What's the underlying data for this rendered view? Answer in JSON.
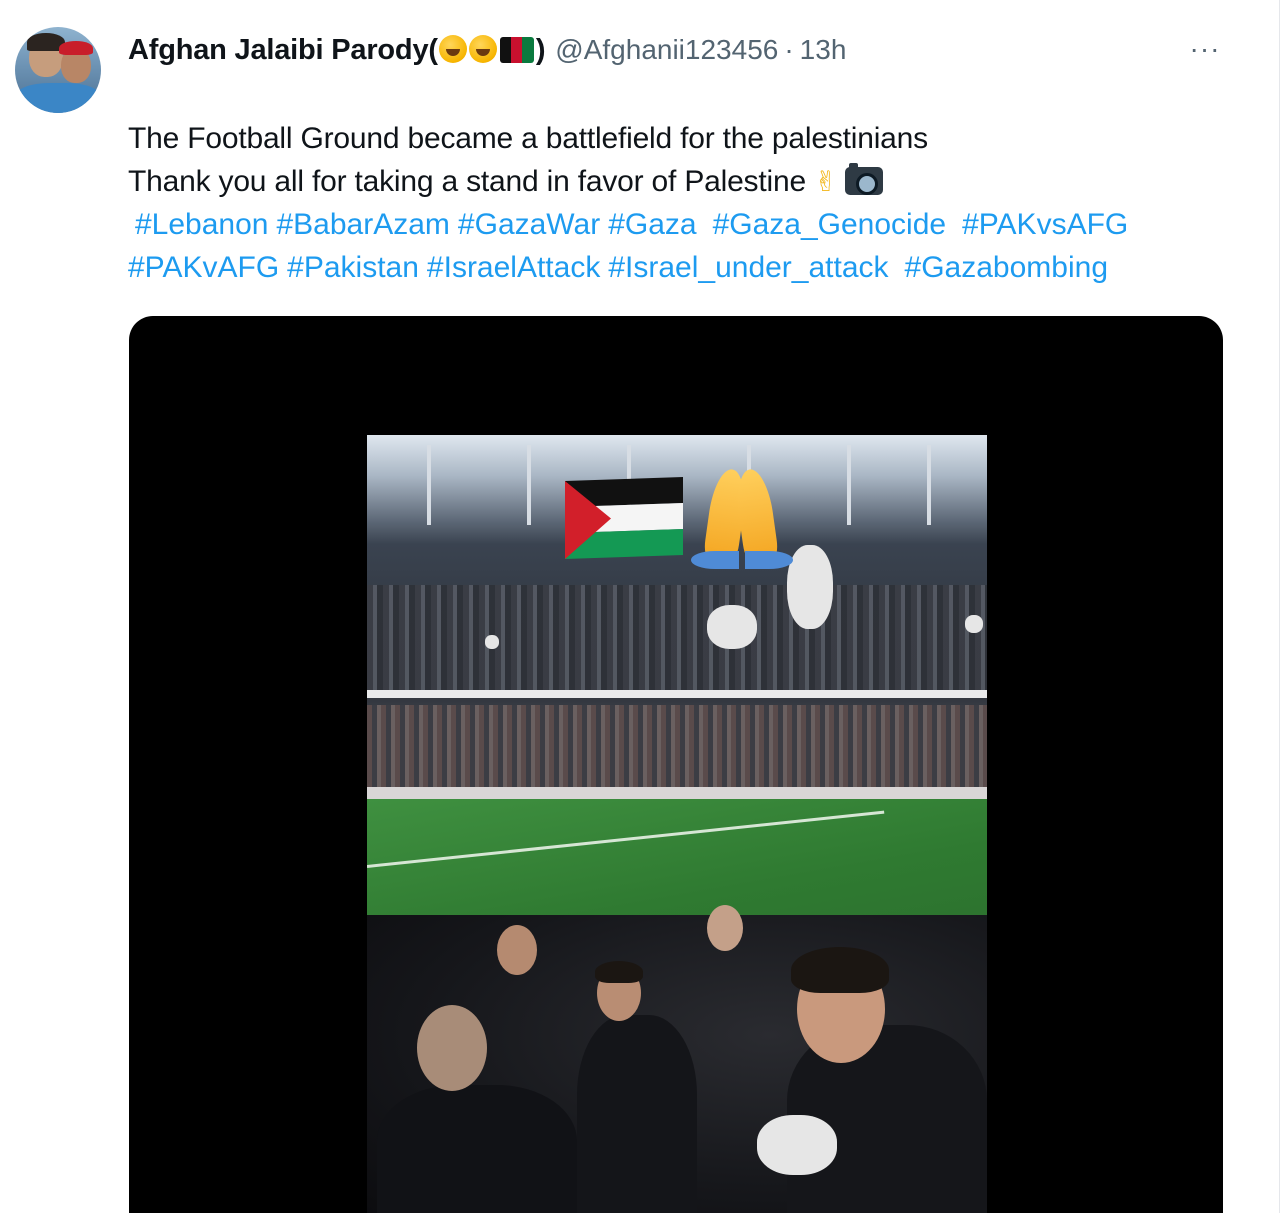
{
  "tweet": {
    "author_name": "Afghan Jalaibi Parody(",
    "author_name_close": ")",
    "handle": "@Afghanii123456",
    "separator": "·",
    "time": "13h",
    "more_label": "···",
    "text_line1": "The Football Ground became a battlefield for the palestinians",
    "text_line2": "Thank you all for taking a stand in favor of Palestine",
    "hashtags_row1": [
      "#Lebanon",
      "#BabarAzam",
      "#GazaWar",
      "#Gaza",
      "#Gaza_Genocide",
      "#PAKvsAFG"
    ],
    "hashtags_row2": [
      "#PAKvAFG",
      "#Pakistan",
      "#IsraelAttack",
      "#Israel_under_attack",
      "#Gazabombing"
    ]
  },
  "icons": {
    "more": "more-options-icon",
    "laugh": "rolling-laughing-emoji-icon",
    "afghan_flag": "afghanistan-flag-emoji-icon",
    "peace": "victory-hand-emoji-icon",
    "camera": "camera-emoji-icon",
    "palestine_flag": "palestine-flag-emoji-icon",
    "pray": "folded-hands-emoji-icon"
  },
  "colors": {
    "link": "#1d9bf0",
    "secondary_text": "#536471",
    "primary_text": "#0f1419"
  }
}
